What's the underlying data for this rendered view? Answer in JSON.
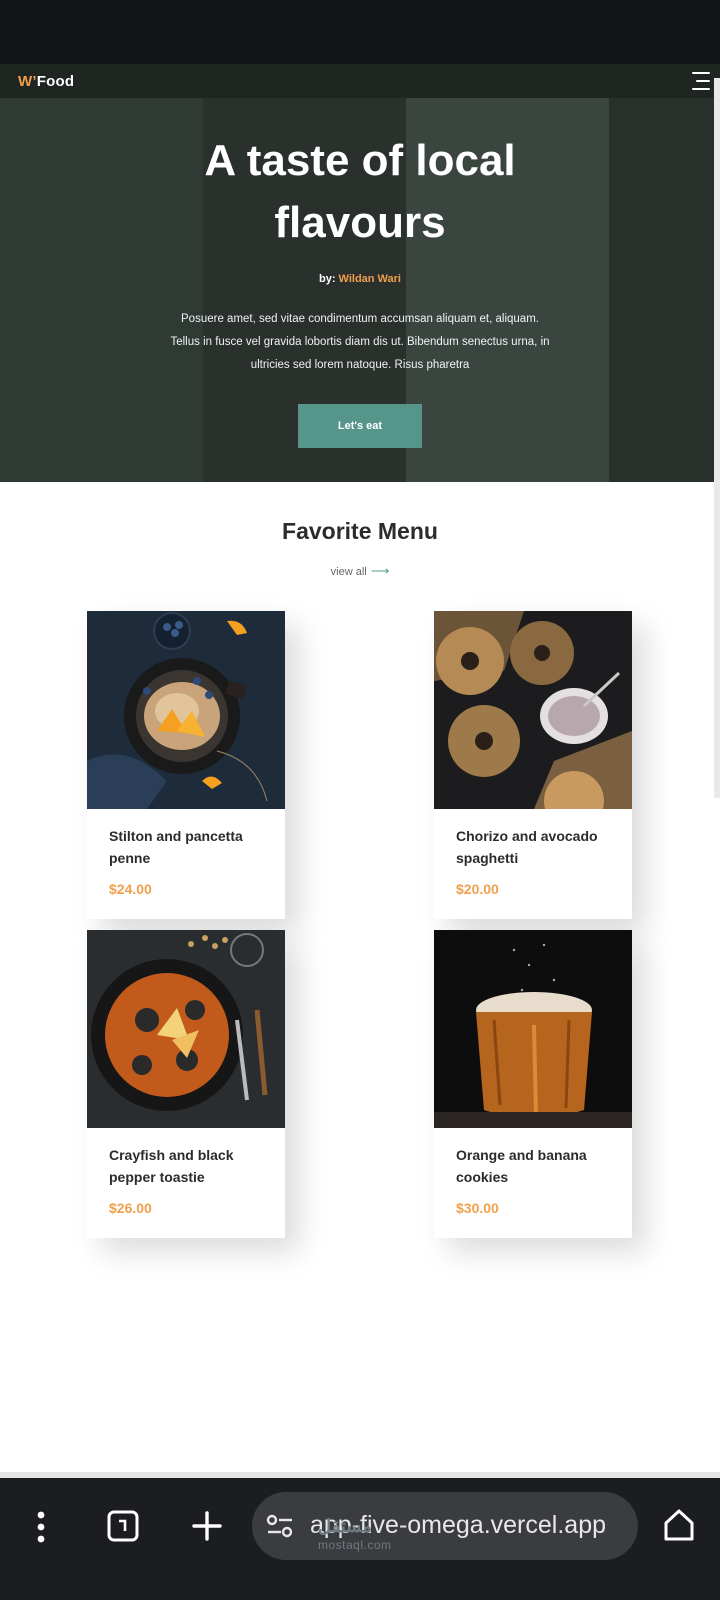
{
  "brand": {
    "logo_prefix": "W’",
    "logo_text": "Food"
  },
  "hero": {
    "title_line1": "A taste of local",
    "title_line2": "flavours",
    "by_label": "by:",
    "author": "Wildan Wari",
    "description": "Posuere amet, sed vitae condimentum accumsan aliquam et, aliquam. Tellus in fusce vel gravida lobortis diam dis ut. Bibendum senectus urna, in ultricies sed lorem natoque. Risus pharetra",
    "cta_label": "Let's eat"
  },
  "menu": {
    "title": "Favorite Menu",
    "view_all": "view all",
    "items": [
      {
        "name": "Stilton and pancetta penne",
        "price": "$24.00",
        "image_icon": "pancake-bowl-photo"
      },
      {
        "name": "Chorizo and avocado spaghetti",
        "price": "$20.00",
        "image_icon": "bagels-photo"
      },
      {
        "name": "Crayfish and black pepper toastie",
        "price": "$26.00",
        "image_icon": "paella-pan-photo"
      },
      {
        "name": "Orange and banana cookies",
        "price": "$30.00",
        "image_icon": "bread-loaf-photo"
      }
    ]
  },
  "browser": {
    "url": "app-five-omega.vercel.app",
    "watermark": "mostaql.com",
    "watermark_ar": "مستقل",
    "tab_count": "1",
    "icons": [
      "more-vert-icon",
      "tabs-icon",
      "new-tab-icon",
      "site-settings-icon",
      "home-icon"
    ]
  },
  "colors": {
    "accent_orange": "#f0a04b",
    "teal_button": "#55958a",
    "hero_dark": "#2d342f",
    "nav_bar": "#1f2521",
    "bottom_bar": "#1c1d20"
  }
}
